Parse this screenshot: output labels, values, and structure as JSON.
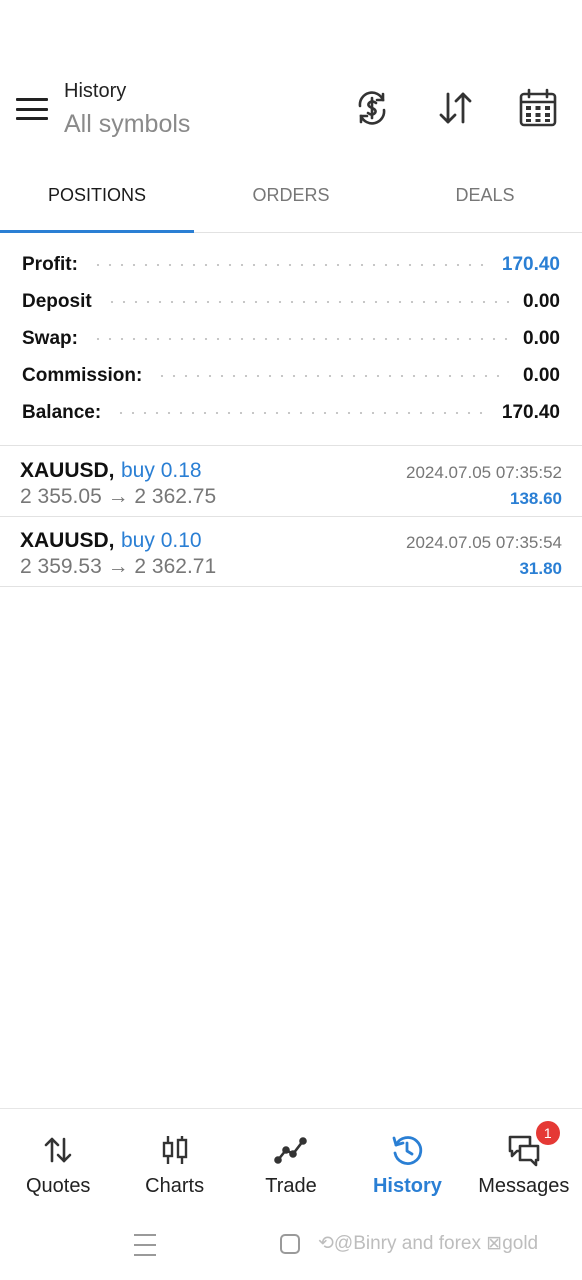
{
  "header": {
    "title": "History",
    "subtitle": "All symbols",
    "icons": [
      "menu-icon",
      "currency-refresh-icon",
      "sort-icon",
      "calendar-icon"
    ]
  },
  "tabs": [
    {
      "label": "POSITIONS",
      "active": true
    },
    {
      "label": "ORDERS",
      "active": false
    },
    {
      "label": "DEALS",
      "active": false
    }
  ],
  "summary": {
    "profit": {
      "label": "Profit:",
      "value": "170.40"
    },
    "deposit": {
      "label": "Deposit",
      "value": "0.00"
    },
    "swap": {
      "label": "Swap:",
      "value": "0.00"
    },
    "commission": {
      "label": "Commission:",
      "value": "0.00"
    },
    "balance": {
      "label": "Balance:",
      "value": "170.40"
    }
  },
  "positions": [
    {
      "symbol": "XAUUSD,",
      "side": "buy 0.18",
      "prices": "2 355.05 → 2 362.75",
      "time": "2024.07.05 07:35:52",
      "profit": "138.60"
    },
    {
      "symbol": "XAUUSD,",
      "side": "buy 0.10",
      "prices": "2 359.53 → 2 362.71",
      "time": "2024.07.05 07:35:54",
      "profit": "31.80"
    }
  ],
  "bottom_nav": [
    {
      "label": "Quotes",
      "icon": "quotes-icon",
      "active": false
    },
    {
      "label": "Charts",
      "icon": "charts-icon",
      "active": false
    },
    {
      "label": "Trade",
      "icon": "trade-icon",
      "active": false
    },
    {
      "label": "History",
      "icon": "history-icon",
      "active": true
    },
    {
      "label": "Messages",
      "icon": "messages-icon",
      "active": false,
      "badge": "1"
    }
  ],
  "watermark": "⟲@Binry and forex ⊠gold",
  "colors": {
    "accent": "#2a7fd4",
    "badge": "#e53935",
    "muted": "#777777"
  }
}
